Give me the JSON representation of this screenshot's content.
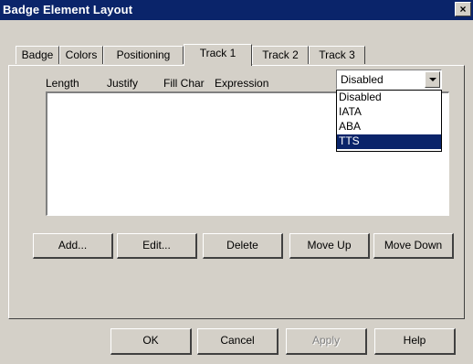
{
  "window": {
    "title": "Badge Element Layout",
    "close_glyph": "×"
  },
  "tabs": [
    {
      "label": "Badge",
      "active": false
    },
    {
      "label": "Colors",
      "active": false
    },
    {
      "label": "Positioning",
      "active": false
    },
    {
      "label": "Track 1",
      "active": true
    },
    {
      "label": "Track 2",
      "active": false
    },
    {
      "label": "Track 3",
      "active": false
    }
  ],
  "columns": [
    "Length",
    "Justify",
    "Fill Char",
    "Expression"
  ],
  "mode_select": {
    "value": "Disabled",
    "options": [
      "Disabled",
      "IATA",
      "ABA",
      "TTS"
    ],
    "highlighted": "TTS"
  },
  "track_buttons": {
    "add": "Add...",
    "edit": "Edit...",
    "delete": "Delete",
    "move_up": "Move Up",
    "move_down": "Move Down"
  },
  "dialog_buttons": {
    "ok": "OK",
    "cancel": "Cancel",
    "apply": "Apply",
    "help": "Help"
  },
  "colors": {
    "titlebar": "#0a246a",
    "face": "#d4d0c8",
    "highlight": "#0a246a"
  }
}
